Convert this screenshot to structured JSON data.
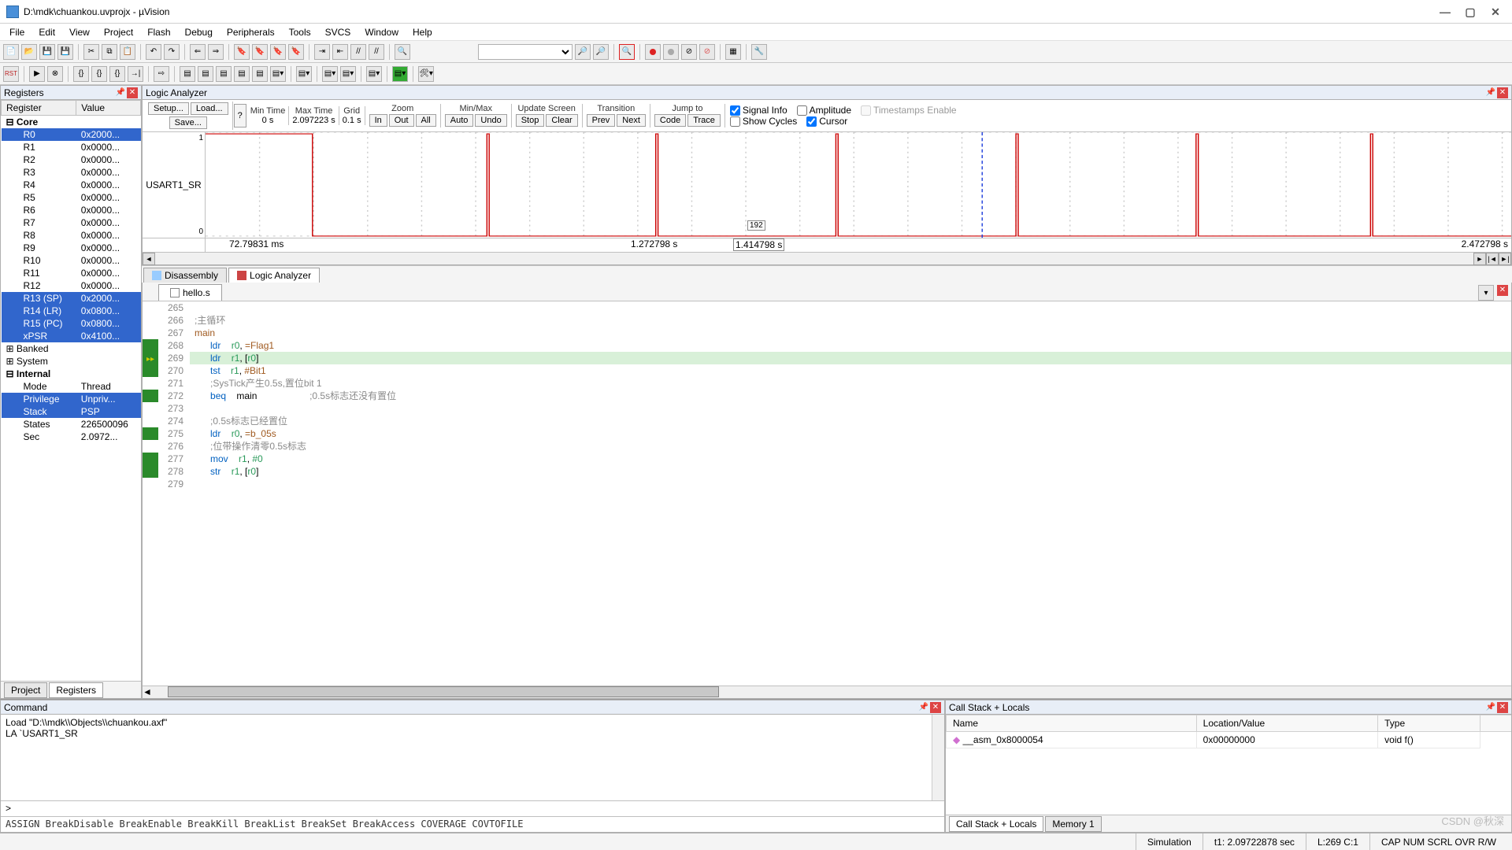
{
  "window": {
    "title": "D:\\mdk\\chuankou.uvprojx - µVision"
  },
  "menu": [
    "File",
    "Edit",
    "View",
    "Project",
    "Flash",
    "Debug",
    "Peripherals",
    "Tools",
    "SVCS",
    "Window",
    "Help"
  ],
  "registers": {
    "title": "Registers",
    "cols": [
      "Register",
      "Value"
    ],
    "rows": [
      {
        "name": "Core",
        "group": true
      },
      {
        "name": "R0",
        "val": "0x2000...",
        "sel": true,
        "indent": true
      },
      {
        "name": "R1",
        "val": "0x0000...",
        "indent": true
      },
      {
        "name": "R2",
        "val": "0x0000...",
        "indent": true
      },
      {
        "name": "R3",
        "val": "0x0000...",
        "indent": true
      },
      {
        "name": "R4",
        "val": "0x0000...",
        "indent": true
      },
      {
        "name": "R5",
        "val": "0x0000...",
        "indent": true
      },
      {
        "name": "R6",
        "val": "0x0000...",
        "indent": true
      },
      {
        "name": "R7",
        "val": "0x0000...",
        "indent": true
      },
      {
        "name": "R8",
        "val": "0x0000...",
        "indent": true
      },
      {
        "name": "R9",
        "val": "0x0000...",
        "indent": true
      },
      {
        "name": "R10",
        "val": "0x0000...",
        "indent": true
      },
      {
        "name": "R11",
        "val": "0x0000...",
        "indent": true
      },
      {
        "name": "R12",
        "val": "0x0000...",
        "indent": true
      },
      {
        "name": "R13 (SP)",
        "val": "0x2000...",
        "sel": true,
        "indent": true
      },
      {
        "name": "R14 (LR)",
        "val": "0x0800...",
        "sel": true,
        "indent": true
      },
      {
        "name": "R15 (PC)",
        "val": "0x0800...",
        "sel": true,
        "indent": true
      },
      {
        "name": "xPSR",
        "val": "0x4100...",
        "sel": true,
        "indent": true
      },
      {
        "name": "Banked",
        "groupc": true
      },
      {
        "name": "System",
        "groupc": true
      },
      {
        "name": "Internal",
        "group": true
      },
      {
        "name": "Mode",
        "val": "Thread",
        "indent": true
      },
      {
        "name": "Privilege",
        "val": "Unpriv...",
        "sel": true,
        "indent": true
      },
      {
        "name": "Stack",
        "val": "PSP",
        "sel": true,
        "indent": true
      },
      {
        "name": "States",
        "val": "226500096",
        "indent": true
      },
      {
        "name": "Sec",
        "val": "2.0972...",
        "indent": true
      }
    ],
    "tabs": [
      "Project",
      "Registers"
    ]
  },
  "la": {
    "title": "Logic Analyzer",
    "buttons": {
      "setup": "Setup...",
      "load": "Load...",
      "save": "Save..."
    },
    "mintime": {
      "lbl": "Min Time",
      "val": "0 s"
    },
    "maxtime": {
      "lbl": "Max Time",
      "val": "2.097223 s"
    },
    "grid": {
      "lbl": "Grid",
      "val": "0.1 s"
    },
    "zoom": {
      "lbl": "Zoom",
      "in": "In",
      "out": "Out",
      "all": "All"
    },
    "minmax": {
      "lbl": "Min/Max",
      "auto": "Auto",
      "undo": "Undo"
    },
    "update": {
      "lbl": "Update Screen",
      "stop": "Stop",
      "clear": "Clear"
    },
    "transition": {
      "lbl": "Transition",
      "prev": "Prev",
      "next": "Next"
    },
    "jump": {
      "lbl": "Jump to",
      "code": "Code",
      "trace": "Trace"
    },
    "checks": {
      "signal": "Signal Info",
      "amp": "Amplitude",
      "ts": "Timestamps Enable",
      "cycles": "Show Cycles",
      "cursor": "Cursor"
    },
    "signal": "USART1_SR",
    "ylabels": {
      "top": "1",
      "bot": "0"
    },
    "axis_left": "72.79831 ms",
    "axis_mid": "1.272798 s",
    "axis_right": "2.472798 s",
    "cursor_val": "192",
    "cursor_time": "1.414798 s",
    "tabs": [
      "Disassembly",
      "Logic Analyzer"
    ]
  },
  "editor": {
    "file": "hello.s",
    "lines": [
      {
        "n": 265,
        "raw": ""
      },
      {
        "n": 266,
        "raw": ";主循环",
        "cls": "cmt"
      },
      {
        "n": 267,
        "raw": "main",
        "cls": "lbl"
      },
      {
        "n": 268,
        "bp": true,
        "code": [
          [
            "      "
          ],
          [
            "ldr",
            "kw"
          ],
          [
            "    "
          ],
          [
            "r0",
            "reg"
          ],
          [
            ", "
          ],
          [
            "=Flag1",
            "lbl"
          ]
        ]
      },
      {
        "n": 269,
        "bp": true,
        "cur": true,
        "hl": true,
        "code": [
          [
            "      "
          ],
          [
            "ldr",
            "kw"
          ],
          [
            "    "
          ],
          [
            "r1",
            "reg"
          ],
          [
            ", ["
          ],
          [
            "r0",
            "reg"
          ],
          [
            "]"
          ]
        ]
      },
      {
        "n": 270,
        "bp": true,
        "code": [
          [
            "      "
          ],
          [
            "tst",
            "kw"
          ],
          [
            "    "
          ],
          [
            "r1",
            "reg"
          ],
          [
            ", "
          ],
          [
            "#Bit1",
            "lbl"
          ]
        ]
      },
      {
        "n": 271,
        "raw": "      ;SysTick产生0.5s,置位bit 1",
        "cls": "cmt"
      },
      {
        "n": 272,
        "bp": true,
        "code": [
          [
            "      "
          ],
          [
            "beq",
            "kw"
          ],
          [
            "    main                    "
          ],
          [
            ";0.5s标志还没有置位",
            "cmt"
          ]
        ]
      },
      {
        "n": 273,
        "raw": ""
      },
      {
        "n": 274,
        "raw": "      ;0.5s标志已经置位",
        "cls": "cmt"
      },
      {
        "n": 275,
        "bp": true,
        "code": [
          [
            "      "
          ],
          [
            "ldr",
            "kw"
          ],
          [
            "    "
          ],
          [
            "r0",
            "reg"
          ],
          [
            ", "
          ],
          [
            "=b_05s",
            "lbl"
          ]
        ]
      },
      {
        "n": 276,
        "raw": "      ;位带操作清零0.5s标志",
        "cls": "cmt"
      },
      {
        "n": 277,
        "bp": true,
        "code": [
          [
            "      "
          ],
          [
            "mov",
            "kw"
          ],
          [
            "    "
          ],
          [
            "r1",
            "reg"
          ],
          [
            ", "
          ],
          [
            "#0",
            "num"
          ]
        ]
      },
      {
        "n": 278,
        "bp": true,
        "code": [
          [
            "      "
          ],
          [
            "str",
            "kw"
          ],
          [
            "    "
          ],
          [
            "r1",
            "reg"
          ],
          [
            ", ["
          ],
          [
            "r0",
            "reg"
          ],
          [
            "]"
          ]
        ]
      },
      {
        "n": 279,
        "raw": ""
      }
    ]
  },
  "command": {
    "title": "Command",
    "body": [
      "Load \"D:\\\\mdk\\\\Objects\\\\chuankou.axf\"",
      "LA `USART1_SR"
    ],
    "prompt": ">",
    "hints": "ASSIGN BreakDisable BreakEnable BreakKill BreakList BreakSet BreakAccess COVERAGE COVTOFILE"
  },
  "callstack": {
    "title": "Call Stack + Locals",
    "cols": [
      "Name",
      "Location/Value",
      "Type"
    ],
    "rows": [
      {
        "name": "__asm_0x8000054",
        "loc": "0x00000000",
        "type": "void f()"
      }
    ],
    "tabs": [
      "Call Stack + Locals",
      "Memory 1"
    ]
  },
  "status": {
    "mode": "Simulation",
    "time": "t1: 2.09722878 sec",
    "pos": "L:269 C:1",
    "caps": "CAP  NUM  SCRL  OVR  R/W"
  },
  "watermark": "CSDN @秋深"
}
